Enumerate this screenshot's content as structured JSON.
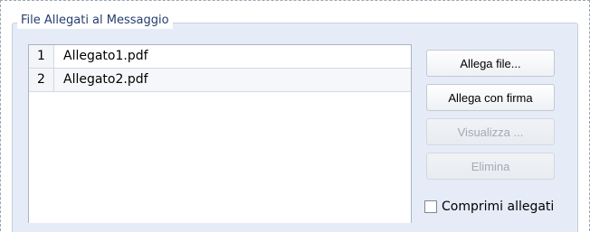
{
  "attachments": {
    "title": "File Allegati al Messaggio",
    "rows": [
      {
        "index": "1",
        "filename": "Allegato1.pdf"
      },
      {
        "index": "2",
        "filename": "Allegato2.pdf"
      }
    ],
    "buttons": {
      "attach": "Allega file...",
      "attach_signed": "Allega con firma",
      "view": "Visualizza ...",
      "delete": "Elimina"
    },
    "compress": {
      "label": "Comprimi allegati",
      "checked": false
    }
  },
  "colors": {
    "panel_background": "#e5ecf8",
    "legend_text": "#243d6e",
    "disabled_text": "#a4abb5"
  }
}
